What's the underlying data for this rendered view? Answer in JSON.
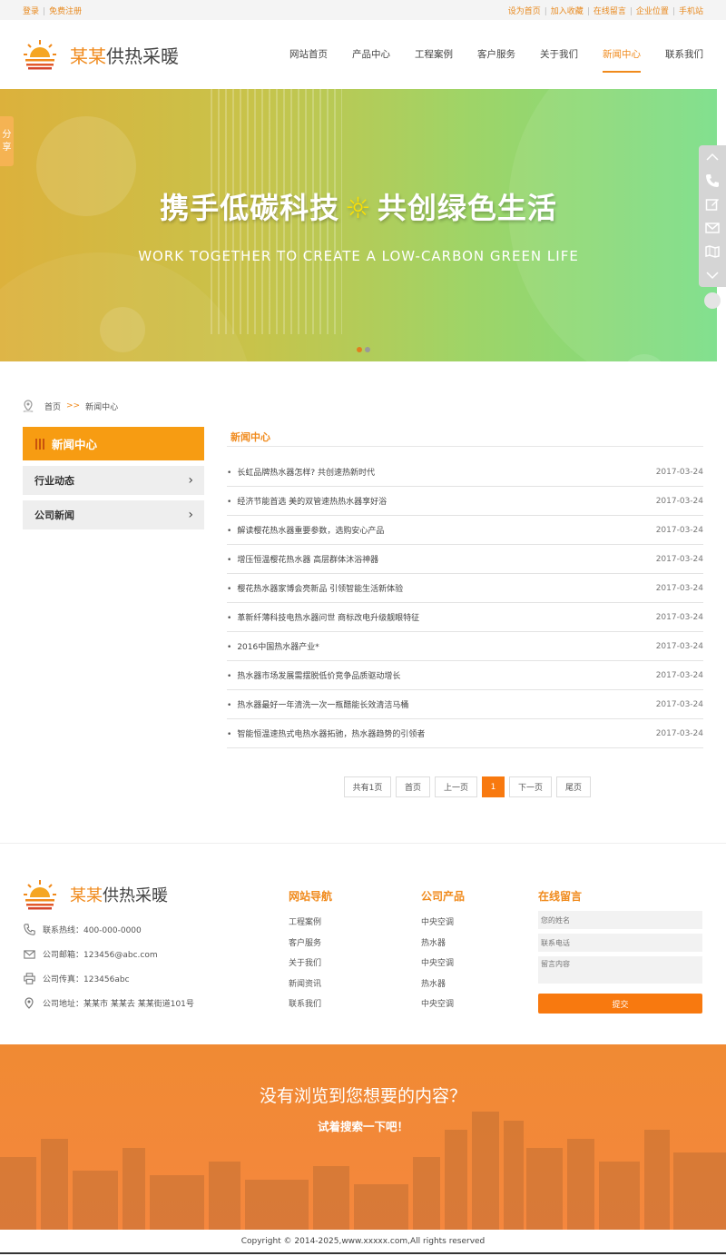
{
  "topbar": {
    "left": [
      "登录",
      "免费注册"
    ],
    "right": [
      "设为首页",
      "加入收藏",
      "在线留言",
      "企业位置",
      "手机站"
    ]
  },
  "logo": {
    "highlight": "某某",
    "rest": "供热采暖"
  },
  "nav": [
    "网站首页",
    "产品中心",
    "工程案例",
    "客户服务",
    "关于我们",
    "新闻中心",
    "联系我们"
  ],
  "banner": {
    "title_left": "携手低碳科技",
    "sun_glyph": "☼",
    "title_right": "共创绿色生活",
    "subtitle": "WORK TOGETHER TO CREATE A LOW-CARBON GREEN LIFE"
  },
  "share": "分享",
  "breadcrumb": {
    "home": "首页",
    "arrow": ">>",
    "current": "新闻中心"
  },
  "sidebar": {
    "title": "新闻中心",
    "items": [
      "行业动态",
      "公司新闻"
    ]
  },
  "content": {
    "title": "新闻中心",
    "news": [
      {
        "title": "长虹品牌热水器怎样? 共创速热新时代",
        "date": "2017-03-24"
      },
      {
        "title": "经济节能首选 美的双管速热热水器享好浴",
        "date": "2017-03-24"
      },
      {
        "title": "解读樱花热水器重要参数，选购安心产品",
        "date": "2017-03-24"
      },
      {
        "title": "增压恒温樱花热水器 高层群体沐浴神器",
        "date": "2017-03-24"
      },
      {
        "title": "樱花热水器家博会亮新品 引领智能生活新体验",
        "date": "2017-03-24"
      },
      {
        "title": "革新纤薄科技电热水器问世 商标改电升级靓眼特征",
        "date": "2017-03-24"
      },
      {
        "title": "2016中国热水器产业*",
        "date": "2017-03-24"
      },
      {
        "title": "热水器市场发展需摆脱低价竞争品质驱动增长",
        "date": "2017-03-24"
      },
      {
        "title": "热水器最好一年清洗一次一瓶醋能长效清洁马桶",
        "date": "2017-03-24"
      },
      {
        "title": "智能恒温速热式电热水器拓驰，热水器趋势的引领者",
        "date": "2017-03-24"
      }
    ]
  },
  "pager": {
    "total": "共有1页",
    "first": "首页",
    "prev": "上一页",
    "current": "1",
    "next": "下一页",
    "last": "尾页"
  },
  "footer": {
    "contact": [
      {
        "icon": "phone-icon",
        "text": "联系热线：400-000-0000"
      },
      {
        "icon": "mail-icon",
        "text": "公司邮箱：123456@abc.com"
      },
      {
        "icon": "printer-icon",
        "text": "公司传真：123456abc"
      },
      {
        "icon": "location-icon",
        "text": "公司地址：某某市 某某去 某某街道101号"
      }
    ],
    "nav_title": "网站导航",
    "nav_links": [
      "工程案例",
      "客户服务",
      "关于我们",
      "新闻资讯",
      "联系我们"
    ],
    "products_title": "公司产品",
    "products": [
      "中央空调",
      "热水器",
      "中央空调",
      "热水器",
      "中央空调"
    ],
    "form_title": "在线留言",
    "form": {
      "name_placeholder": "您的姓名",
      "phone_placeholder": "联系电话",
      "message_placeholder": "留言内容",
      "submit": "提交"
    }
  },
  "search_band": {
    "title": "没有浏览到您想要的内容？",
    "subtitle": "试着搜索一下吧！"
  },
  "copyright": "Copyright © 2014-2025,www.xxxxx.com,All rights reserved",
  "colors": {
    "accent": "#f08a1c",
    "button": "#f8790f",
    "sidebar_head": "#f79c12"
  }
}
